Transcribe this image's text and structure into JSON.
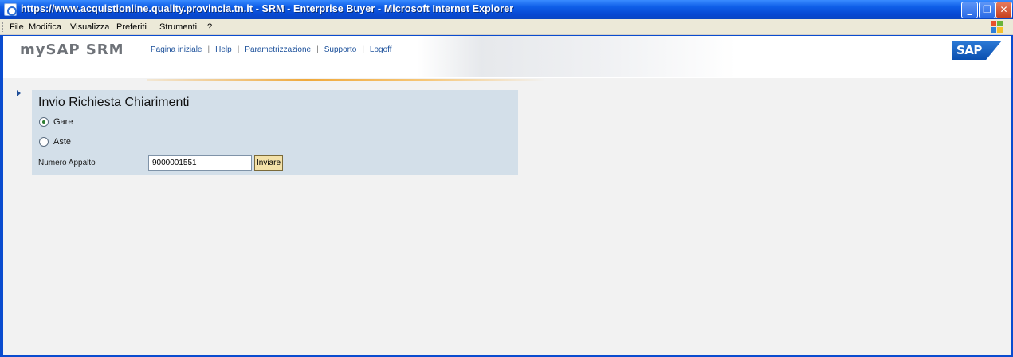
{
  "window": {
    "title": "https://www.acquistionline.quality.provincia.tn.it - SRM - Enterprise Buyer - Microsoft Internet Explorer"
  },
  "menu": [
    "File",
    "Modifica",
    "Visualizza",
    "Preferiti",
    "Strumenti",
    "?"
  ],
  "header": {
    "logo": "mySAP SRM",
    "links": [
      "Pagina iniziale",
      "Help",
      "Parametrizzazione",
      "Supporto",
      "Logoff"
    ],
    "separator": "|",
    "brand": "SAP"
  },
  "panel": {
    "title": "Invio Richiesta Chiarimenti",
    "options": [
      {
        "label": "Gare",
        "selected": true
      },
      {
        "label": "Aste",
        "selected": false
      }
    ],
    "field_label": "Numero Appalto",
    "field_value": "9000001551",
    "button_label": "Inviare"
  },
  "colors": {
    "titlebar": "#0a4ccf",
    "panel_bg": "#d3dfe9",
    "link": "#1a4f9a",
    "button_bg": "#f3e1a8",
    "accent_line": "#f0a93c"
  }
}
